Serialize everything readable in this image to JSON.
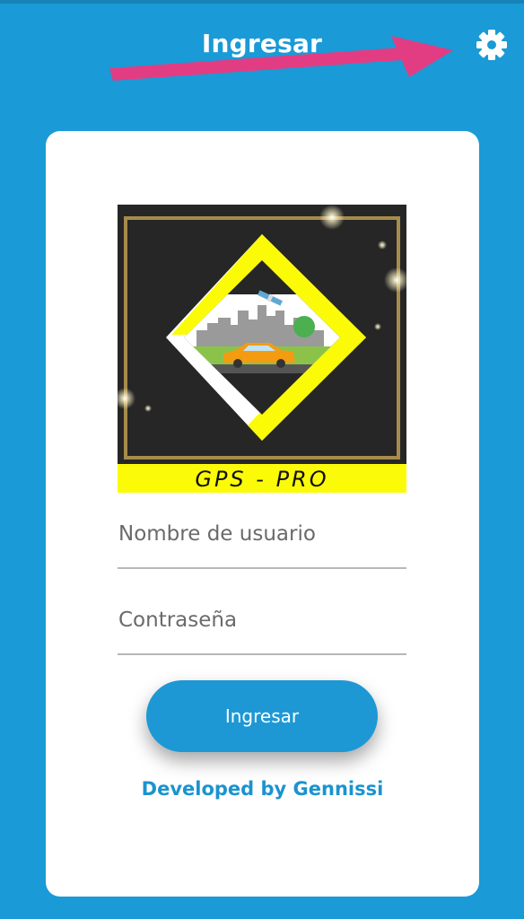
{
  "header": {
    "title": "Ingresar",
    "settings_icon": "gear-icon",
    "annotation_arrow_color": "#e23d83"
  },
  "colors": {
    "background": "#1a9ad6",
    "card": "#ffffff",
    "button": "#1d98d5",
    "link": "#1b93cf",
    "logo_yellow": "#fbfb08",
    "logo_dark": "#262626",
    "logo_gold": "#a78b4c"
  },
  "logo": {
    "text": "GPS - PRO"
  },
  "form": {
    "username_placeholder": "Nombre de usuario",
    "password_placeholder": "Contraseña",
    "submit_label": "Ingresar"
  },
  "footer": {
    "credit": "Developed by Gennissi"
  }
}
